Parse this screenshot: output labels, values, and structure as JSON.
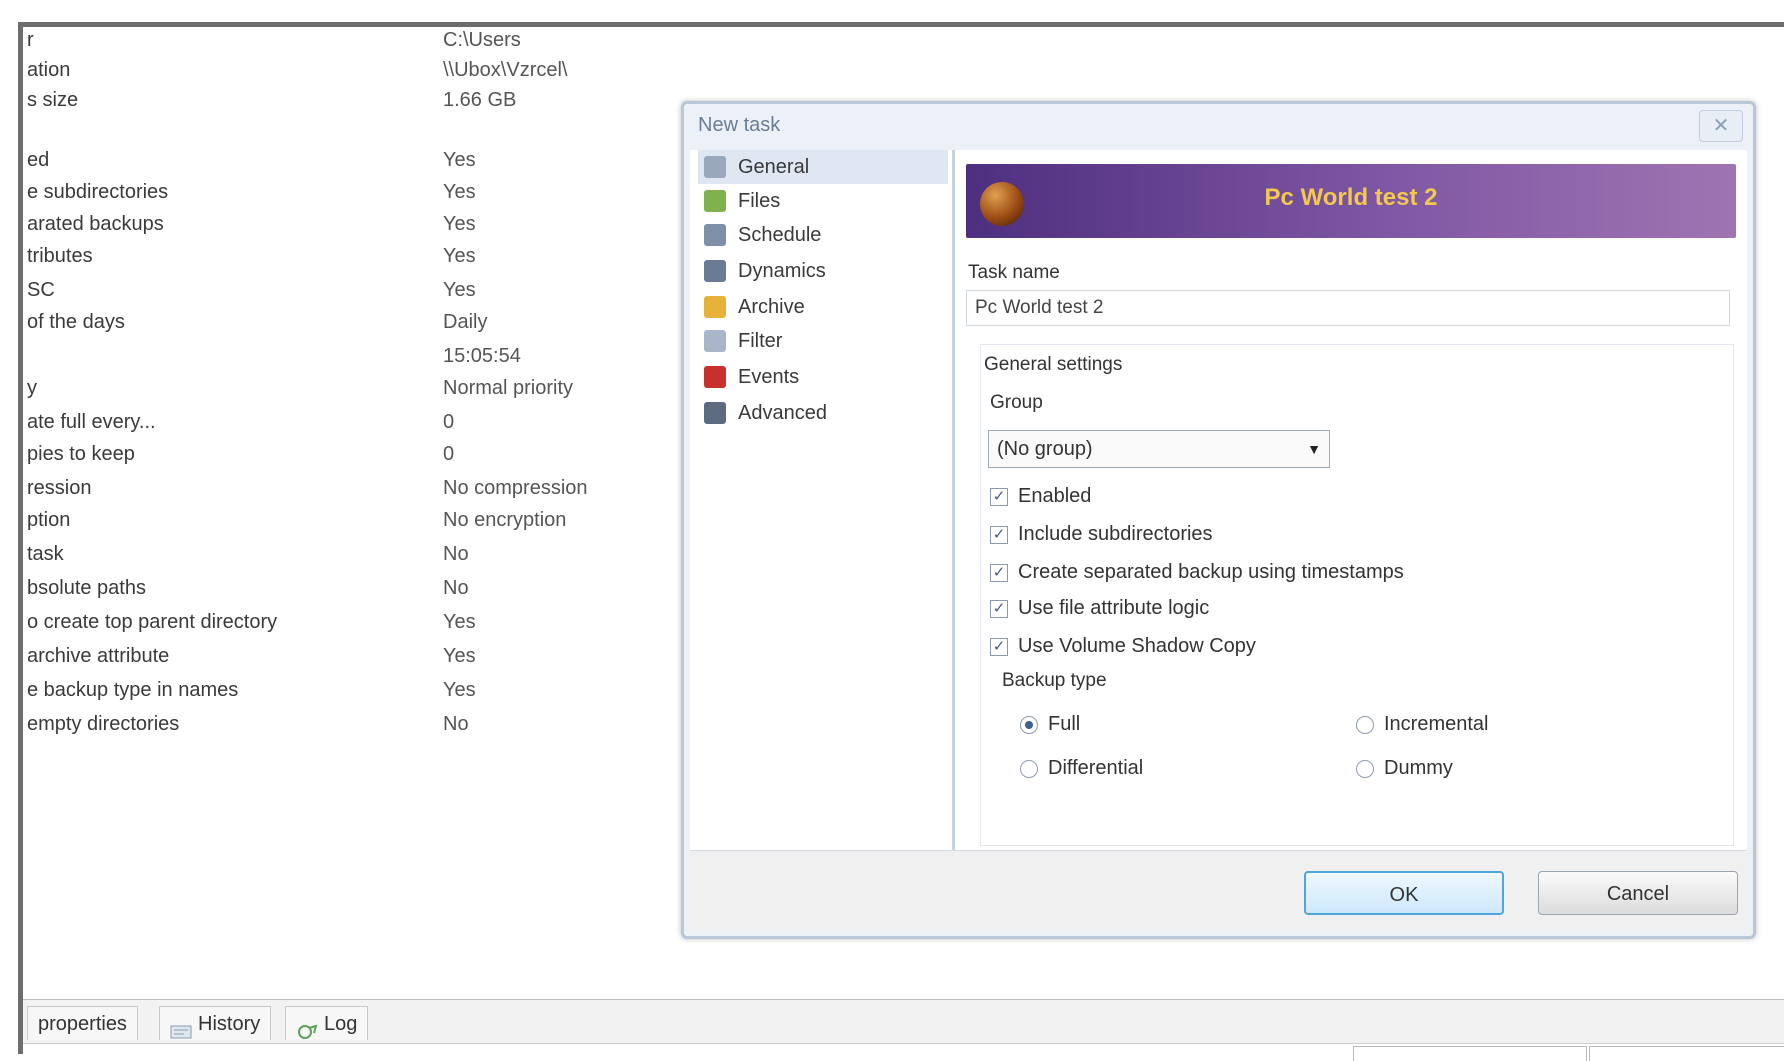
{
  "properties": [
    {
      "name": "r",
      "value": "C:\\Users"
    },
    {
      "name": "ation",
      "value": "\\\\Ubox\\Vzrcel\\"
    },
    {
      "name": "s size",
      "value": "1.66 GB"
    },
    {
      "name": "",
      "value": ""
    },
    {
      "name": "ed",
      "value": "Yes"
    },
    {
      "name": "e subdirectories",
      "value": "Yes"
    },
    {
      "name": "arated backups",
      "value": "Yes"
    },
    {
      "name": "tributes",
      "value": "Yes"
    },
    {
      "name": "SC",
      "value": "Yes"
    },
    {
      "name": "of the days",
      "value": "Daily"
    },
    {
      "name": "",
      "value": "15:05:54"
    },
    {
      "name": "y",
      "value": "Normal priority"
    },
    {
      "name": "ate full every...",
      "value": "0"
    },
    {
      "name": "pies to keep",
      "value": "0"
    },
    {
      "name": "ression",
      "value": "No compression"
    },
    {
      "name": "ption",
      "value": "No encryption"
    },
    {
      "name": "task",
      "value": "No"
    },
    {
      "name": "bsolute paths",
      "value": "No"
    },
    {
      "name": "o create top parent directory",
      "value": "Yes"
    },
    {
      "name": "archive attribute",
      "value": "Yes"
    },
    {
      "name": "e backup type in names",
      "value": "Yes"
    },
    {
      "name": "empty directories",
      "value": "No"
    }
  ],
  "bottom_tabs": [
    {
      "label": "properties",
      "icon": "properties-icon"
    },
    {
      "label": "History",
      "icon": "history-icon"
    },
    {
      "label": "Log",
      "icon": "log-icon"
    }
  ],
  "dialog": {
    "title": "New task",
    "close_label": "✕",
    "nav": [
      {
        "label": "General",
        "icon": "general-icon",
        "color": "#9aa8bd",
        "active": true
      },
      {
        "label": "Files",
        "icon": "files-icon",
        "color": "#7fb24a"
      },
      {
        "label": "Schedule",
        "icon": "schedule-icon",
        "color": "#7e8fa8"
      },
      {
        "label": "Dynamics",
        "icon": "dynamics-icon",
        "color": "#6b7b95"
      },
      {
        "label": "Archive",
        "icon": "archive-icon",
        "color": "#e7b23a"
      },
      {
        "label": "Filter",
        "icon": "filter-icon",
        "color": "#a9b6c9"
      },
      {
        "label": "Events",
        "icon": "events-icon",
        "color": "#c8302c"
      },
      {
        "label": "Advanced",
        "icon": "advanced-icon",
        "color": "#5d6b80"
      }
    ],
    "banner_title": "Pc World test 2",
    "task_name_label": "Task name",
    "task_name_value": "Pc World test 2",
    "general_settings_label": "General settings",
    "group_label": "Group",
    "group_value": "(No group)",
    "checkboxes": [
      {
        "label": "Enabled",
        "checked": true
      },
      {
        "label": "Include subdirectories",
        "checked": true
      },
      {
        "label": "Create separated backup using timestamps",
        "checked": true
      },
      {
        "label": "Use file attribute logic",
        "checked": true
      },
      {
        "label": "Use Volume Shadow Copy",
        "checked": true
      }
    ],
    "backup_type_label": "Backup type",
    "backup_types": [
      {
        "label": "Full",
        "selected": true
      },
      {
        "label": "Incremental",
        "selected": false
      },
      {
        "label": "Differential",
        "selected": false
      },
      {
        "label": "Dummy",
        "selected": false
      }
    ],
    "ok_label": "OK",
    "cancel_label": "Cancel"
  },
  "colors": {
    "banner_start": "#4e2f7f",
    "banner_end": "#a074b2",
    "banner_text": "#f3c84c",
    "ok_border": "#4fa6dc"
  }
}
